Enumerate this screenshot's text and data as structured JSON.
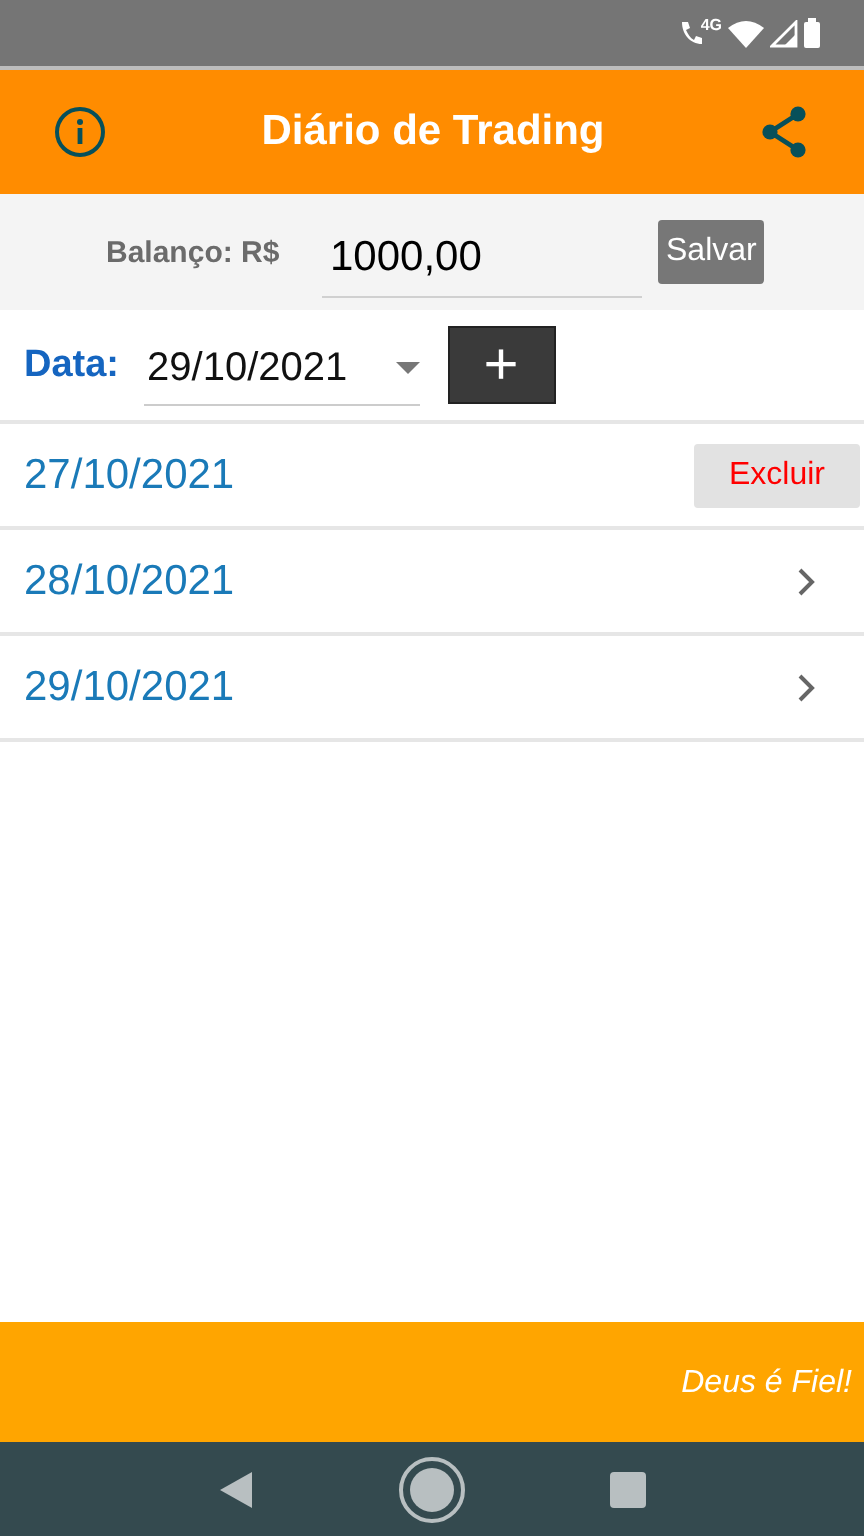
{
  "status_bar": {
    "network": "4G"
  },
  "app_bar": {
    "title": "Diário de Trading"
  },
  "balance": {
    "label": "Balanço: R$",
    "value": "1000,00",
    "button": "Salvar"
  },
  "date_picker": {
    "label": "Data:",
    "value": "29/10/2021",
    "add_button": "+"
  },
  "entries": [
    {
      "date": "27/10/2021",
      "kind": "delete",
      "action": "Excluir"
    },
    {
      "date": "28/10/2021",
      "kind": "chevron"
    },
    {
      "date": "29/10/2021",
      "kind": "chevron"
    }
  ],
  "footer": {
    "text": "Deus é Fiel!"
  }
}
